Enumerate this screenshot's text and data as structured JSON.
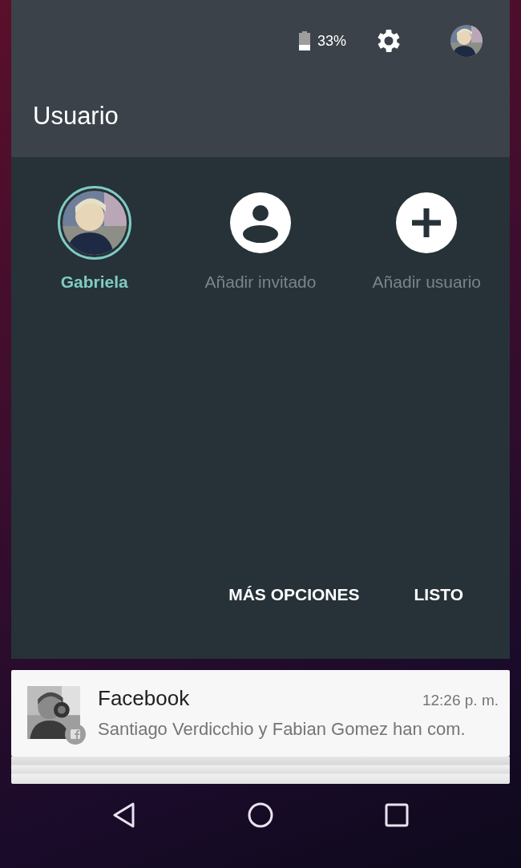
{
  "status": {
    "battery": "33%"
  },
  "panel": {
    "title": "Usuario",
    "users": [
      {
        "name": "Gabriela",
        "selected": true
      },
      {
        "name": "Añadir invitado",
        "kind": "guest",
        "selected": false
      },
      {
        "name": "Añadir usuario",
        "kind": "add",
        "selected": false
      }
    ],
    "actions": [
      "MÁS OPCIONES",
      "LISTO"
    ]
  },
  "notification": {
    "app": "Facebook",
    "time": "12:26 p. m.",
    "text": "Santiago Verdicchio y Fabian Gomez han com."
  }
}
